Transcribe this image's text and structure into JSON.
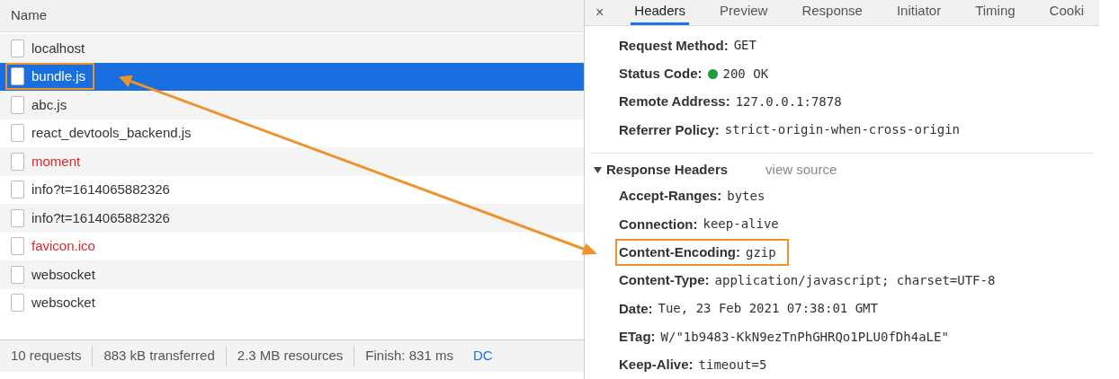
{
  "requests": {
    "column": "Name",
    "rows": [
      {
        "name": "localhost",
        "selected": false,
        "error": false,
        "highlighted": false
      },
      {
        "name": "bundle.js",
        "selected": true,
        "error": false,
        "highlighted": true
      },
      {
        "name": "abc.js",
        "selected": false,
        "error": false,
        "highlighted": false
      },
      {
        "name": "react_devtools_backend.js",
        "selected": false,
        "error": false,
        "highlighted": false
      },
      {
        "name": "moment",
        "selected": false,
        "error": true,
        "highlighted": false
      },
      {
        "name": "info?t=1614065882326",
        "selected": false,
        "error": false,
        "highlighted": false
      },
      {
        "name": "info?t=1614065882326",
        "selected": false,
        "error": false,
        "highlighted": false
      },
      {
        "name": "favicon.ico",
        "selected": false,
        "error": true,
        "highlighted": false
      },
      {
        "name": "websocket",
        "selected": false,
        "error": false,
        "highlighted": false
      },
      {
        "name": "websocket",
        "selected": false,
        "error": false,
        "highlighted": false
      }
    ]
  },
  "status_bar": [
    {
      "text": "10 requests",
      "kind": "plain"
    },
    {
      "text": "883 kB transferred",
      "kind": "plain"
    },
    {
      "text": "2.3 MB resources",
      "kind": "plain"
    },
    {
      "text": "Finish: 831 ms",
      "kind": "plain"
    },
    {
      "text": "DC",
      "kind": "link"
    }
  ],
  "details": {
    "close": "×",
    "tabs": [
      {
        "label": "Headers",
        "selected": true
      },
      {
        "label": "Preview",
        "selected": false
      },
      {
        "label": "Response",
        "selected": false
      },
      {
        "label": "Initiator",
        "selected": false
      },
      {
        "label": "Timing",
        "selected": false
      },
      {
        "label": "Cooki",
        "selected": false
      }
    ],
    "general": [
      {
        "name": "Request Method:",
        "value": "GET",
        "highlighted": false
      },
      {
        "name": "Status Code:",
        "value": "200 OK",
        "color": "#1f9d3a",
        "highlighted": false
      },
      {
        "name": "Remote Address:",
        "value": "127.0.0.1:7878",
        "highlighted": false
      },
      {
        "name": "Referrer Policy:",
        "value": "strict-origin-when-cross-origin",
        "highlighted": false
      }
    ],
    "response_headers": {
      "title": "Response Headers",
      "expanded": true,
      "link": "view source",
      "items": [
        {
          "name": "Accept-Ranges:",
          "value": "bytes",
          "highlighted": false
        },
        {
          "name": "Connection:",
          "value": "keep-alive",
          "highlighted": false
        },
        {
          "name": "Content-Encoding:",
          "value": "gzip",
          "highlighted": true
        },
        {
          "name": "Content-Type:",
          "value": "application/javascript; charset=UTF-8",
          "highlighted": false
        },
        {
          "name": "Date:",
          "value": "Tue, 23 Feb 2021 07:38:01 GMT",
          "highlighted": false
        },
        {
          "name": "ETag:",
          "value": "W/\"1b9483-KkN9ezTnPhGHRQo1PLU0fDh4aLE\"",
          "highlighted": false
        },
        {
          "name": "Keep-Alive:",
          "value": "timeout=5",
          "highlighted": false
        }
      ]
    }
  }
}
